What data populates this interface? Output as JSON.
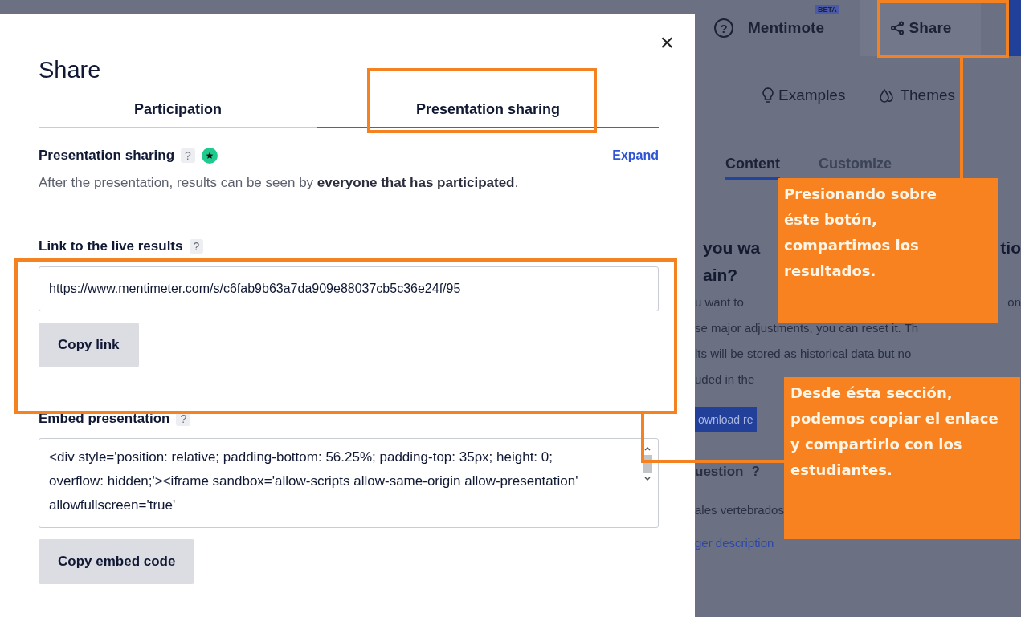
{
  "background": {
    "help": "?",
    "mentimote": "Mentimote",
    "beta": "BETA",
    "share": "Share",
    "examples": "Examples",
    "themes": "Themes",
    "tabs": [
      {
        "label": "Content",
        "selected": true
      },
      {
        "label": "Customize",
        "selected": false
      }
    ],
    "lines": [
      {
        "kind": "heading",
        "texts": [
          "you wa",
          "tio"
        ]
      },
      {
        "kind": "heading",
        "texts": [
          "ain?"
        ]
      },
      {
        "kind": "text",
        "texts": [
          "u want to",
          "on"
        ]
      },
      {
        "kind": "text",
        "texts": [
          "se major adjustments, you can reset it. Th"
        ]
      },
      {
        "kind": "text",
        "texts": [
          "lts will be stored as historical data but no"
        ]
      },
      {
        "kind": "text",
        "texts": [
          "uded in the"
        ]
      },
      {
        "kind": "button",
        "texts": [
          "ownload re"
        ]
      },
      {
        "kind": "label",
        "texts": [
          "uestion",
          "?"
        ]
      },
      {
        "kind": "text",
        "texts": [
          "ales vertebrados"
        ]
      },
      {
        "kind": "link",
        "texts": [
          "ger description"
        ]
      }
    ]
  },
  "modal": {
    "title": "Share",
    "close": "×",
    "tabs": [
      {
        "label": "Participation",
        "selected": false
      },
      {
        "label": "Presentation sharing",
        "selected": true
      }
    ],
    "sharing": {
      "heading": "Presentation sharing",
      "help": "?",
      "expand": "Expand",
      "description": "After the presentation, results can be seen by **everyone that has participated**."
    },
    "link": {
      "label": "Link to the live results",
      "help": "?",
      "value": "https://www.mentimeter.com/s/c6fab9b63a7da909e88037cb5c36e24f/95",
      "button": "Copy link"
    },
    "embed": {
      "label": "Embed presentation",
      "help": "?",
      "value": "<div style='position: relative; padding-bottom: 56.25%; padding-top: 35px; height: 0; overflow: hidden;'><iframe sandbox='allow-scripts allow-same-origin allow-presentation' allowfullscreen='true'",
      "button": "Copy embed code"
    }
  },
  "annotations": [
    {
      "text": "Presionando sobre éste botón, compartimos los resultados."
    },
    {
      "text": "Desde ésta sección, podemos copiar el enlace y compartirlo con los estudiantes."
    }
  ]
}
